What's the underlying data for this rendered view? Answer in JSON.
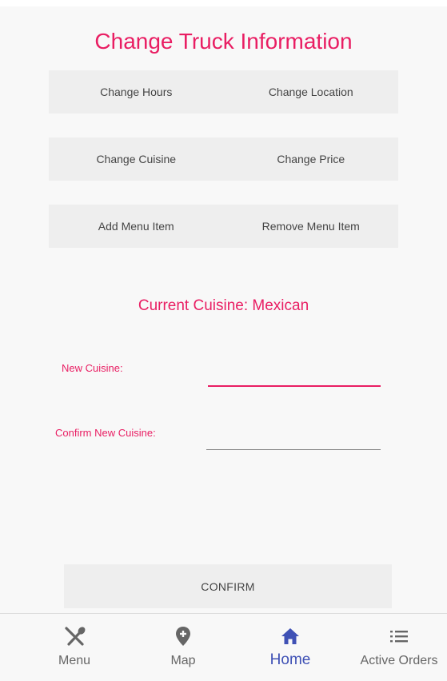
{
  "header": {
    "title": "Change Truck Information"
  },
  "options": [
    [
      "Change Hours",
      "Change Location"
    ],
    [
      "Change Cuisine",
      "Change Price"
    ],
    [
      "Add Menu Item",
      "Remove Menu Item"
    ]
  ],
  "current": {
    "text": "Current Cuisine: Mexican"
  },
  "form": {
    "new_label": "New Cuisine:",
    "new_value": "",
    "confirm_label": "Confirm New Cuisine:",
    "confirm_value": "",
    "submit_label": "CONFIRM"
  },
  "nav": {
    "items": [
      {
        "label": "Menu",
        "icon": "utensils-icon"
      },
      {
        "label": "Map",
        "icon": "map-pin-plus-icon"
      },
      {
        "label": "Home",
        "icon": "home-icon"
      },
      {
        "label": "Active Orders",
        "icon": "list-icon"
      }
    ],
    "active": "Home"
  },
  "colors": {
    "accent": "#e91e63",
    "nav_active": "#3f51b5",
    "button_bg": "#eeeeee",
    "background": "#f8f8f8"
  }
}
